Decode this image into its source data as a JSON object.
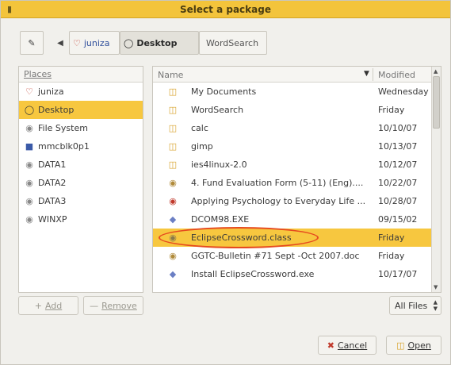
{
  "window": {
    "title": "Select a package"
  },
  "pathbar": {
    "items": [
      {
        "label": "juniza",
        "icon": "home-folder-icon"
      },
      {
        "label": "Desktop",
        "icon": "desktop-icon",
        "active": true
      },
      {
        "label": "WordSearch"
      }
    ]
  },
  "places": {
    "header": "Places",
    "items": [
      {
        "label": "juniza",
        "icon": "home-folder-icon"
      },
      {
        "label": "Desktop",
        "icon": "desktop-icon",
        "selected": true
      },
      {
        "label": "File System",
        "icon": "drive-icon"
      },
      {
        "label": "mmcblk0p1",
        "icon": "sd-card-icon"
      },
      {
        "label": "DATA1",
        "icon": "drive-icon"
      },
      {
        "label": "DATA2",
        "icon": "drive-icon"
      },
      {
        "label": "DATA3",
        "icon": "drive-icon"
      },
      {
        "label": "WINXP",
        "icon": "drive-icon"
      }
    ]
  },
  "files": {
    "columns": {
      "name": "Name",
      "modified": "Modified"
    },
    "rows": [
      {
        "name": "My Documents",
        "modified": "Wednesday",
        "icon": "folder-icon"
      },
      {
        "name": "WordSearch",
        "modified": "Friday",
        "icon": "folder-icon"
      },
      {
        "name": "calc",
        "modified": "10/10/07",
        "icon": "folder-icon"
      },
      {
        "name": "gimp",
        "modified": "10/13/07",
        "icon": "folder-icon"
      },
      {
        "name": "ies4linux-2.0",
        "modified": "10/12/07",
        "icon": "folder-icon"
      },
      {
        "name": "4. Fund Evaluation Form (5-11) (Eng)....",
        "modified": "10/22/07",
        "icon": "document-icon"
      },
      {
        "name": "Applying Psychology to Everyday Life ...",
        "modified": "10/28/07",
        "icon": "document-icon"
      },
      {
        "name": "DCOM98.EXE",
        "modified": "09/15/02",
        "icon": "executable-icon"
      },
      {
        "name": "EclipseCrossword.class",
        "modified": "Friday",
        "icon": "document-icon",
        "selected": true
      },
      {
        "name": "GGTC-Bulletin #71 Sept -Oct 2007.doc",
        "modified": "Friday",
        "icon": "document-icon"
      },
      {
        "name": "Install EclipseCrossword.exe",
        "modified": "10/17/07",
        "icon": "executable-icon"
      }
    ]
  },
  "buttons": {
    "add": "Add",
    "remove": "Remove",
    "filter": "All Files",
    "cancel": "Cancel",
    "open": "Open"
  },
  "colors": {
    "titlebar": "#f3c43b",
    "selection": "#f7c73f",
    "highlight_ring": "#e64a1f"
  }
}
